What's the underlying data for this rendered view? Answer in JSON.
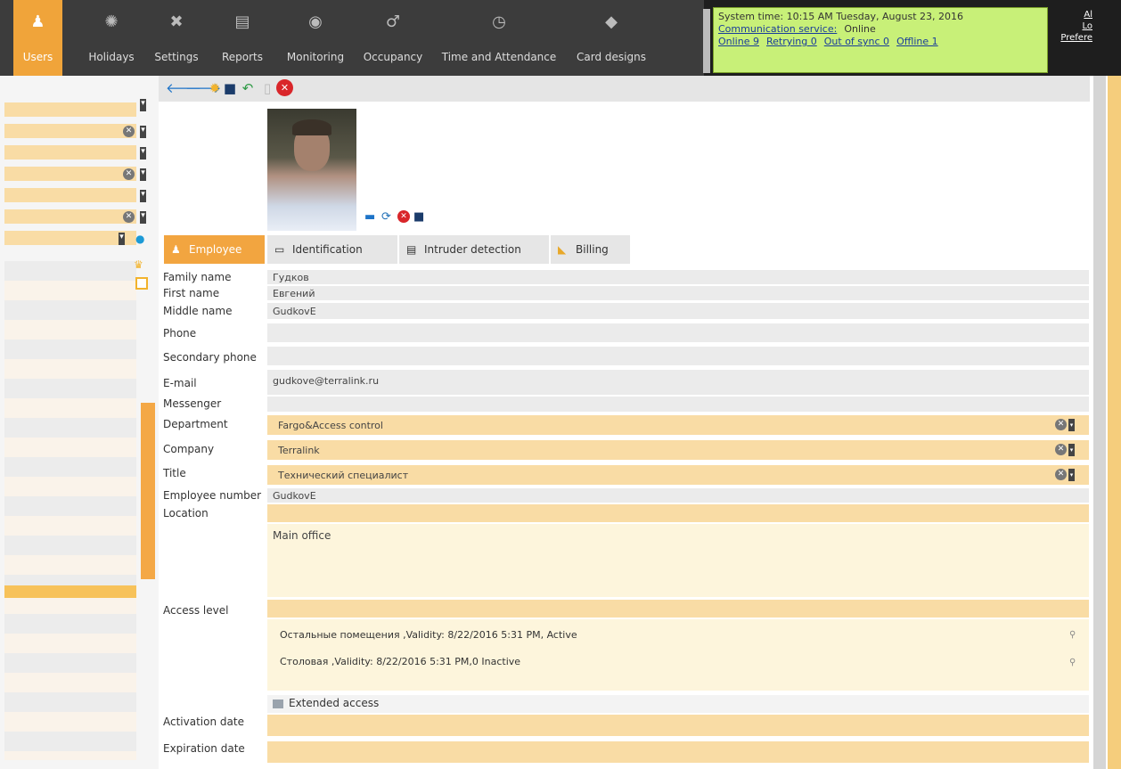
{
  "nav": {
    "tabs": [
      {
        "label": "Users",
        "icon": "users-icon",
        "glyph": "♟"
      },
      {
        "label": "Holidays",
        "icon": "holidays-icon",
        "glyph": "✺"
      },
      {
        "label": "Settings",
        "icon": "settings-icon",
        "glyph": "✖"
      },
      {
        "label": "Reports",
        "icon": "reports-icon",
        "glyph": "▤"
      },
      {
        "label": "Monitoring",
        "icon": "monitoring-icon",
        "glyph": "◉"
      },
      {
        "label": "Occupancy",
        "icon": "occupancy-icon",
        "glyph": "♂"
      },
      {
        "label": "Time and Attendance",
        "icon": "clock-icon",
        "glyph": "◷"
      },
      {
        "label": "Card designs",
        "icon": "card-icon",
        "glyph": "◆"
      }
    ]
  },
  "status": {
    "line1": "System time: 10:15 AM Tuesday, August 23, 2016",
    "comm_label": "Communication service:",
    "comm_value": "Online",
    "online": "Online 9",
    "retrying": "Retrying 0",
    "out_of_sync": "Out of sync 0",
    "offline": "Offline 1"
  },
  "right_links": {
    "l1": "Al",
    "l2": "Lo",
    "l3": "Prefere"
  },
  "tabs": {
    "employee": "Employee",
    "identification": "Identification",
    "intruder": "Intruder detection",
    "billing": "Billing"
  },
  "labels": {
    "family_name": "Family name",
    "first_name": "First name",
    "middle_name": "Middle name",
    "phone": "Phone",
    "secondary_phone": "Secondary phone",
    "email": "E-mail",
    "messenger": "Messenger",
    "department": "Department",
    "company": "Company",
    "title": "Title",
    "employee_number": "Employee number",
    "location": "Location",
    "access_level": "Access level",
    "activation_date": "Activation date",
    "expiration_date": "Expiration date"
  },
  "values": {
    "family_name": "Гудков",
    "first_name": "Евгений",
    "middle_name": "GudkovE",
    "email": "gudkove@terralink.ru",
    "department": "Fargo&Access control",
    "company": "Terralink",
    "title": "Технический специалист",
    "employee_number": "GudkovE",
    "location_text": "Main office"
  },
  "access_levels": [
    "Остальные помещения ,Validity: 8/22/2016 5:31 PM, Active",
    "Столовая ,Validity: 8/22/2016 5:31 PM,0 Inactive"
  ],
  "extended_access": "Extended access",
  "colors": {
    "accent": "#f0a43a",
    "status_bg": "#c8f078",
    "field_yellow": "#f9dca5"
  }
}
